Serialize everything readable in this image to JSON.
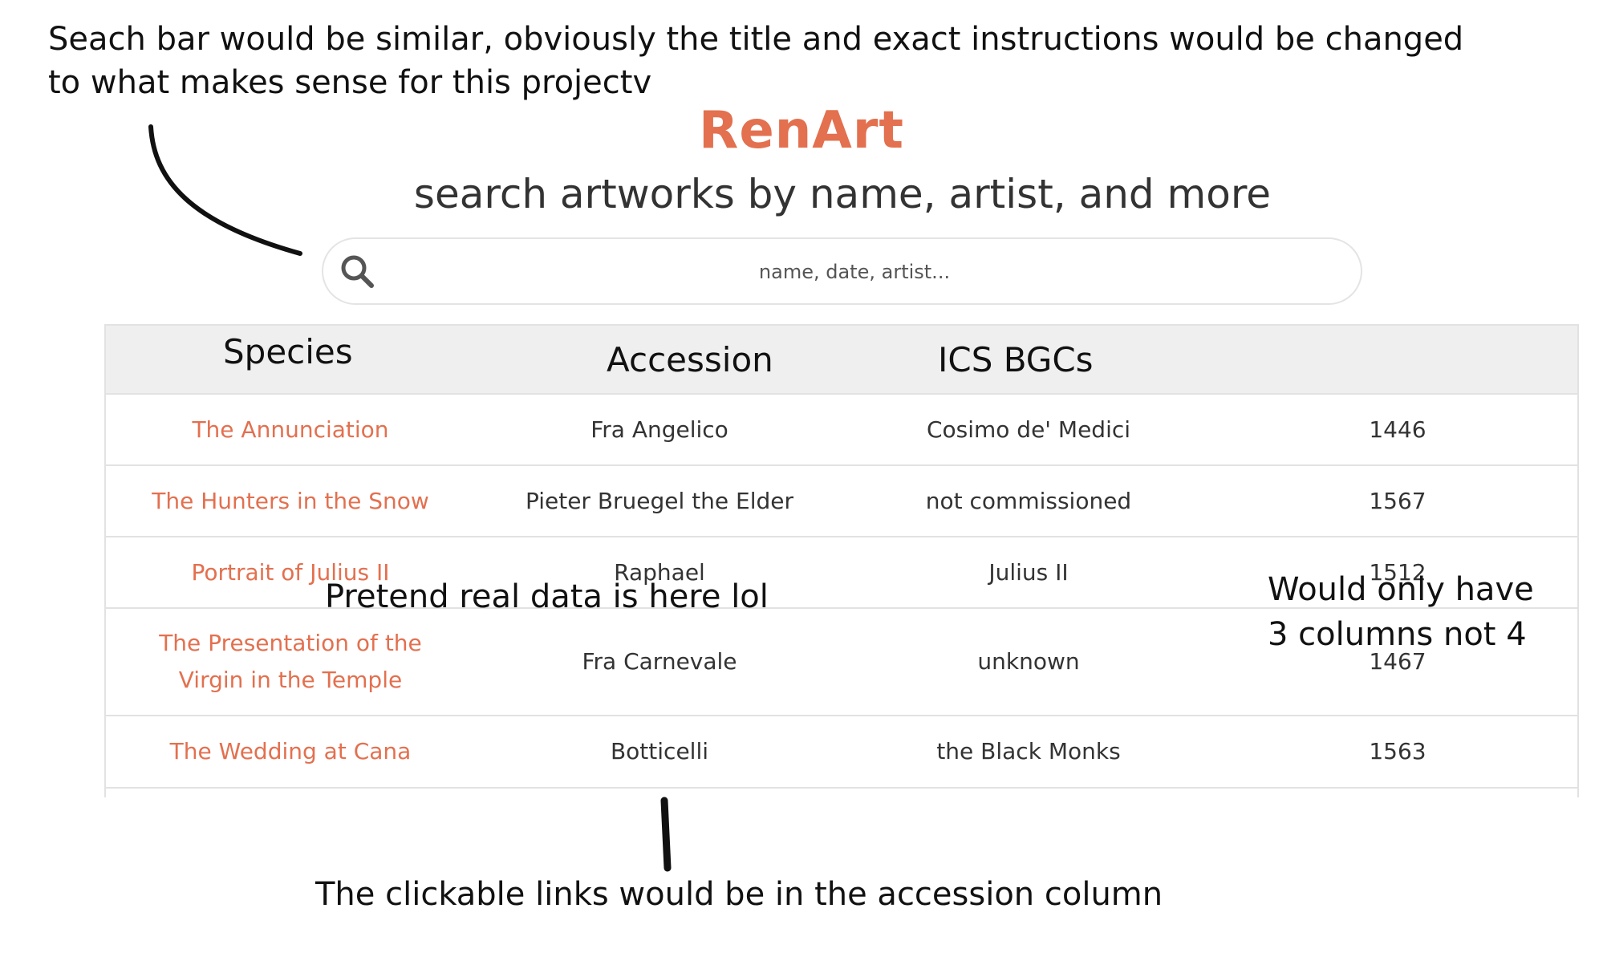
{
  "annotations": {
    "top_line1": "Seach bar would be similar, obviously the title and exact instructions would be changed",
    "top_line2": "to what makes sense for this projectv",
    "middle": "Pretend real data is here lol",
    "right_line1": "Would only have",
    "right_line2": "3 columns not 4",
    "bottom": "The clickable links would be in the accession column"
  },
  "brand": "RenArt",
  "subtitle": "search artworks by name, artist, and more",
  "search": {
    "placeholder": "name, date, artist..."
  },
  "table": {
    "headers": [
      "Species",
      "Accession",
      "ICS BGCs"
    ],
    "rows": [
      [
        "The Annunciation",
        "Fra Angelico",
        "Cosimo de' Medici",
        "1446"
      ],
      [
        "The Hunters in the Snow",
        "Pieter Bruegel the Elder",
        "not commissioned",
        "1567"
      ],
      [
        "Portrait of Julius II",
        "Raphael",
        "Julius II",
        "1512"
      ],
      [
        "The Presentation of the Virgin in the Temple",
        "Fra Carnevale",
        "unknown",
        "1467"
      ],
      [
        "The Wedding at Cana",
        "Botticelli",
        "the Black Monks",
        "1563"
      ]
    ]
  },
  "colors": {
    "accent": "#e3704f",
    "header_bg": "#efefef",
    "border": "#e2e2e2"
  },
  "icons": [
    "search-icon"
  ]
}
